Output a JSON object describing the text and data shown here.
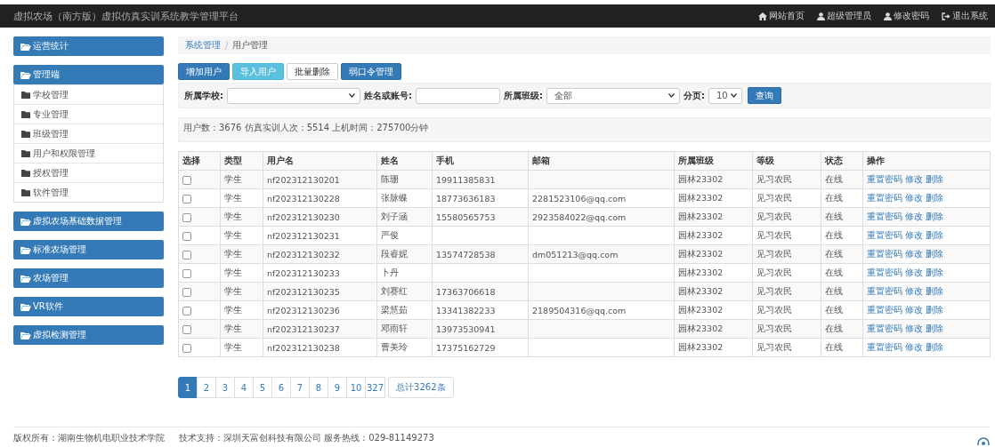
{
  "header": {
    "title": "虚拟农场（南方版）虚拟仿真实训系统教学管理平台",
    "nav": [
      {
        "label": "网站首页"
      },
      {
        "label": "超级管理员"
      },
      {
        "label": "修改密码"
      },
      {
        "label": "退出系统"
      }
    ]
  },
  "sidebar": [
    {
      "label": "运营统计"
    },
    {
      "label": "管理端",
      "children": [
        {
          "label": "学校管理"
        },
        {
          "label": "专业管理"
        },
        {
          "label": "班级管理"
        },
        {
          "label": "用户和权限管理"
        },
        {
          "label": "授权管理"
        },
        {
          "label": "软件管理"
        }
      ]
    },
    {
      "label": "虚拟农场基础数据管理"
    },
    {
      "label": "标准农场管理"
    },
    {
      "label": "农场管理"
    },
    {
      "label": "VR软件"
    },
    {
      "label": "虚拟检测管理"
    }
  ],
  "breadcrumb_separator": "/",
  "breadcrumb": [
    {
      "label": "系统管理",
      "link": true
    },
    {
      "label": "用户管理",
      "link": false
    }
  ],
  "toolbar": [
    {
      "label": "增加用户",
      "kind": "primary"
    },
    {
      "label": "导入用户",
      "kind": "info"
    },
    {
      "label": "批量删除",
      "kind": "default"
    },
    {
      "label": "弱口令管理",
      "kind": "primary"
    }
  ],
  "filters": {
    "school_label": "所属学校:",
    "name_label": "姓名或账号:",
    "class_label": "所属班级:",
    "class_value": "全部",
    "page_size_label": "分页:",
    "page_size_value": "10",
    "query_button": "查询"
  },
  "stats": "用户数：3676   仿真实训人次：5514   上机时间：275700分钟",
  "table": {
    "columns": [
      "选择",
      "类型",
      "用户名",
      "姓名",
      "手机",
      "邮箱",
      "所属班级",
      "等级",
      "状态",
      "操作"
    ],
    "rows": [
      {
        "checked": false,
        "type": "学生",
        "username": "nf202312130201",
        "name": "陈珊",
        "phone": "19911385831",
        "email": "",
        "class": "园林23302",
        "level_name": "见习农民",
        "status": "在线",
        "actions": [
          "重置密码",
          "修改",
          "删除"
        ]
      },
      {
        "checked": false,
        "type": "学生",
        "username": "nf202312130228",
        "name": "张脉蝶",
        "phone": "18773636183",
        "email": "2281523106@qq.com",
        "class": "园林23302",
        "level_name": "见习农民",
        "status": "在线",
        "actions": [
          "重置密码",
          "修改",
          "删除"
        ]
      },
      {
        "checked": false,
        "type": "学生",
        "username": "nf202312130230",
        "name": "刘子涵",
        "phone": "15580565753",
        "email": "2923584022@qq.com",
        "class": "园林23302",
        "level_name": "见习农民",
        "status": "在线",
        "actions": [
          "重置密码",
          "修改",
          "删除"
        ]
      },
      {
        "checked": false,
        "type": "学生",
        "username": "nf202312130231",
        "name": "严俊",
        "phone": "",
        "email": "",
        "class": "园林23302",
        "level_name": "见习农民",
        "status": "在线",
        "actions": [
          "重置密码",
          "修改",
          "删除"
        ]
      },
      {
        "checked": false,
        "type": "学生",
        "username": "nf202312130232",
        "name": "段睿妮",
        "phone": "13574728538",
        "email": "dm051213@qq.com",
        "class": "园林23302",
        "level_name": "见习农民",
        "status": "在线",
        "actions": [
          "重置密码",
          "修改",
          "删除"
        ]
      },
      {
        "checked": false,
        "type": "学生",
        "username": "nf202312130233",
        "name": "卜丹",
        "phone": "",
        "email": "",
        "class": "园林23302",
        "level_name": "见习农民",
        "status": "在线",
        "actions": [
          "重置密码",
          "修改",
          "删除"
        ]
      },
      {
        "checked": false,
        "type": "学生",
        "username": "nf202312130235",
        "name": "刘赛红",
        "phone": "17363706618",
        "email": "",
        "class": "园林23302",
        "level_name": "见习农民",
        "status": "在线",
        "actions": [
          "重置密码",
          "修改",
          "删除"
        ]
      },
      {
        "checked": false,
        "type": "学生",
        "username": "nf202312130236",
        "name": "梁慧茹",
        "phone": "13341382233",
        "email": "2189504316@qq.com",
        "class": "园林23302",
        "level_name": "见习农民",
        "status": "在线",
        "actions": [
          "重置密码",
          "修改",
          "删除"
        ]
      },
      {
        "checked": false,
        "type": "学生",
        "username": "nf202312130237",
        "name": "邓雨轩",
        "phone": "13973530941",
        "email": "",
        "class": "园林23302",
        "level_name": "见习农民",
        "status": "在线",
        "actions": [
          "重置密码",
          "修改",
          "删除"
        ]
      },
      {
        "checked": false,
        "type": "学生",
        "username": "nf202312130238",
        "name": "曹美玲",
        "phone": "17375162729",
        "email": "",
        "class": "园林23302",
        "level_name": "见习农民",
        "status": "在线",
        "actions": [
          "重置密码",
          "修改",
          "删除"
        ]
      }
    ]
  },
  "pagination": {
    "pages": [
      {
        "label": "1",
        "selected": true
      },
      {
        "label": "2",
        "selected": false
      },
      {
        "label": "3",
        "selected": false
      },
      {
        "label": "4",
        "selected": false
      },
      {
        "label": "5",
        "selected": false
      },
      {
        "label": "6",
        "selected": false
      },
      {
        "label": "7",
        "selected": false
      },
      {
        "label": "8",
        "selected": false
      },
      {
        "label": "9",
        "selected": false
      },
      {
        "label": "10",
        "selected": false
      },
      {
        "label": "327",
        "selected": false
      }
    ],
    "total": "总计3262条"
  },
  "footer": {
    "copyright": "版权所有：湖南生物机电职业技术学院",
    "support": "技术支持：深圳天富创科技有限公司 服务热线：029-81149273"
  }
}
